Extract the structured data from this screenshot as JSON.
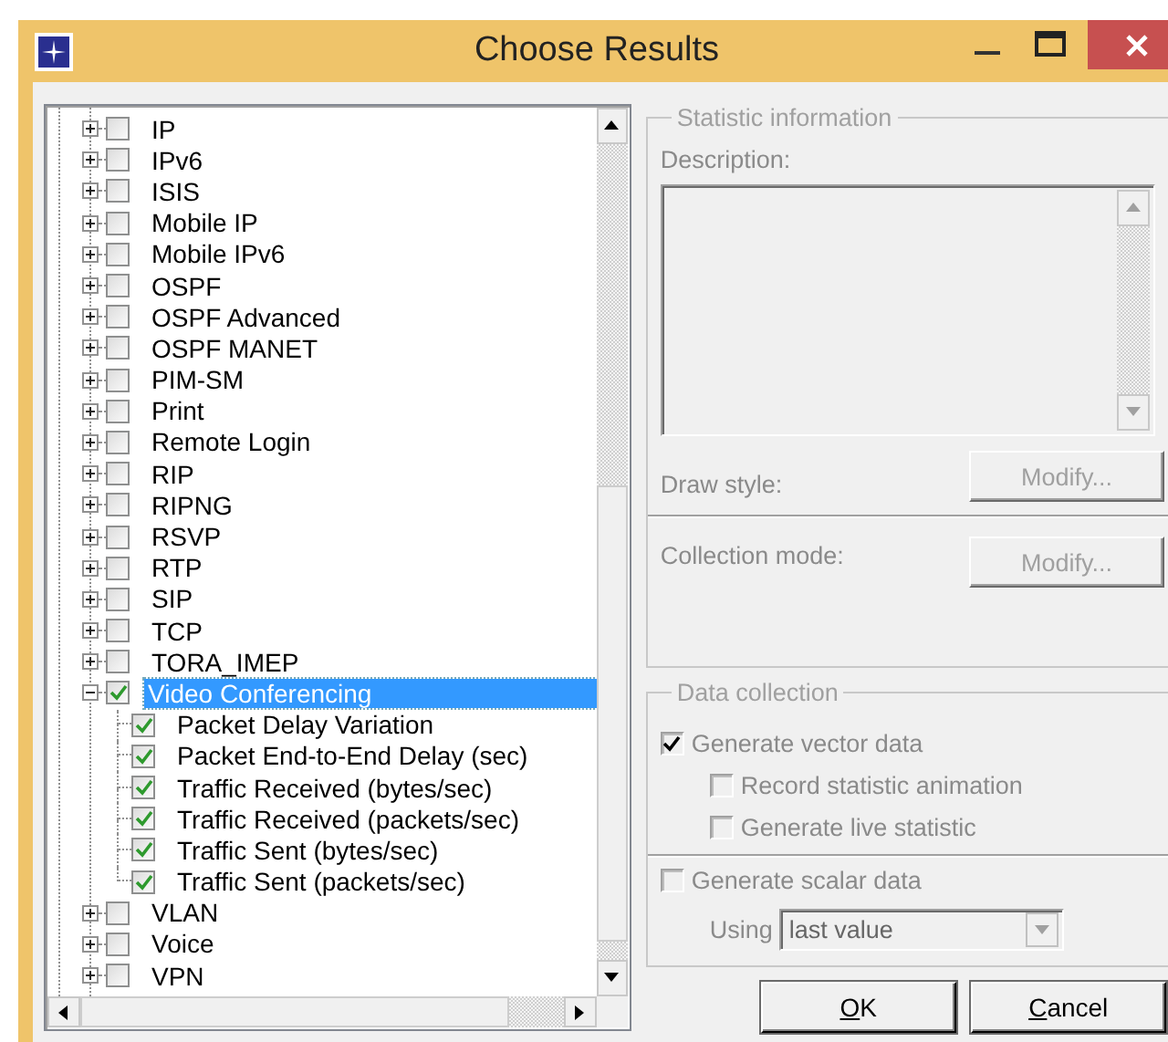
{
  "window": {
    "title": "Choose Results"
  },
  "tree": {
    "items": [
      {
        "label": "IP",
        "checked": false,
        "expanded": false,
        "selected": false
      },
      {
        "label": "IPv6",
        "checked": false,
        "expanded": false,
        "selected": false
      },
      {
        "label": "ISIS",
        "checked": false,
        "expanded": false,
        "selected": false
      },
      {
        "label": "Mobile IP",
        "checked": false,
        "expanded": false,
        "selected": false
      },
      {
        "label": "Mobile IPv6",
        "checked": false,
        "expanded": false,
        "selected": false
      },
      {
        "label": "OSPF",
        "checked": false,
        "expanded": false,
        "selected": false
      },
      {
        "label": "OSPF Advanced",
        "checked": false,
        "expanded": false,
        "selected": false
      },
      {
        "label": "OSPF MANET",
        "checked": false,
        "expanded": false,
        "selected": false
      },
      {
        "label": "PIM-SM",
        "checked": false,
        "expanded": false,
        "selected": false
      },
      {
        "label": "Print",
        "checked": false,
        "expanded": false,
        "selected": false
      },
      {
        "label": "Remote Login",
        "checked": false,
        "expanded": false,
        "selected": false
      },
      {
        "label": "RIP",
        "checked": false,
        "expanded": false,
        "selected": false
      },
      {
        "label": "RIPNG",
        "checked": false,
        "expanded": false,
        "selected": false
      },
      {
        "label": "RSVP",
        "checked": false,
        "expanded": false,
        "selected": false
      },
      {
        "label": "RTP",
        "checked": false,
        "expanded": false,
        "selected": false
      },
      {
        "label": "SIP",
        "checked": false,
        "expanded": false,
        "selected": false
      },
      {
        "label": "TCP",
        "checked": false,
        "expanded": false,
        "selected": false
      },
      {
        "label": "TORA_IMEP",
        "checked": false,
        "expanded": false,
        "selected": false
      },
      {
        "label": "Video Conferencing",
        "checked": true,
        "expanded": true,
        "selected": true,
        "children": [
          {
            "label": "Packet Delay Variation",
            "checked": true,
            "selected": false
          },
          {
            "label": "Packet End-to-End Delay (sec)",
            "checked": true,
            "selected": false
          },
          {
            "label": "Traffic Received (bytes/sec)",
            "checked": true,
            "selected": false
          },
          {
            "label": "Traffic Received (packets/sec)",
            "checked": true,
            "selected": false
          },
          {
            "label": "Traffic Sent (bytes/sec)",
            "checked": true,
            "selected": false
          },
          {
            "label": "Traffic Sent (packets/sec)",
            "checked": true,
            "selected": false
          }
        ]
      },
      {
        "label": "VLAN",
        "checked": false,
        "expanded": false,
        "selected": false
      },
      {
        "label": "Voice",
        "checked": false,
        "expanded": false,
        "selected": false
      },
      {
        "label": "VPN",
        "checked": false,
        "expanded": false,
        "selected": false
      }
    ]
  },
  "statistic_information": {
    "title": "Statistic information",
    "disabled": true,
    "description_label": "Description:",
    "draw_style_label": "Draw style:",
    "draw_style_button": {
      "label": "Modify...",
      "disabled": true
    },
    "collection_mode_label": "Collection mode:",
    "collection_mode_button": {
      "label": "Modify...",
      "disabled": true
    }
  },
  "data_collection": {
    "title": "Data collection",
    "disabled": true,
    "vector": {
      "label": "Generate vector data",
      "checked": true,
      "disabled": true,
      "children": [
        {
          "label": "Record statistic animation",
          "checked": false,
          "disabled": true
        },
        {
          "label": "Generate live statistic",
          "checked": false,
          "disabled": true
        }
      ]
    },
    "scalar": {
      "label": "Generate scalar data",
      "checked": false,
      "disabled": true
    },
    "using_label": "Using",
    "using_value": "last value",
    "using_disabled": true
  },
  "buttons": [
    {
      "label": "OK"
    },
    {
      "label": "Cancel"
    }
  ]
}
